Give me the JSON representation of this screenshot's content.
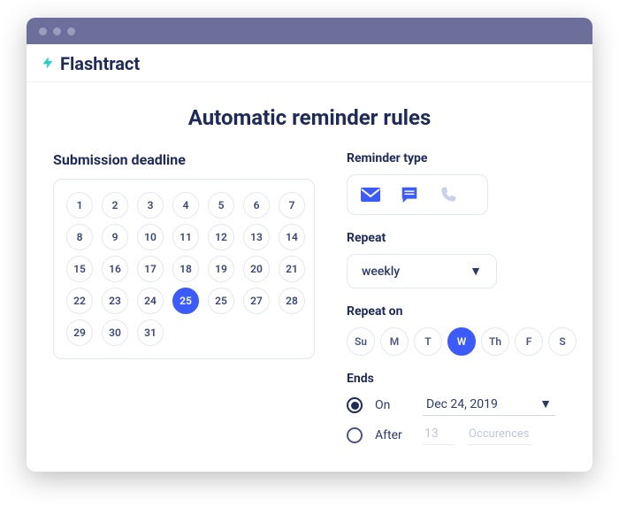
{
  "brand": {
    "name": "Flashtract"
  },
  "page": {
    "title": "Automatic reminder rules"
  },
  "deadline": {
    "label": "Submission deadline",
    "days": [
      "1",
      "2",
      "3",
      "4",
      "5",
      "6",
      "7",
      "8",
      "9",
      "10",
      "11",
      "12",
      "13",
      "14",
      "15",
      "16",
      "17",
      "18",
      "19",
      "20",
      "21",
      "22",
      "23",
      "24",
      "25",
      "25",
      "27",
      "28",
      "29",
      "30",
      "31"
    ],
    "selected_index": 24
  },
  "reminder_type": {
    "label": "Reminder type"
  },
  "repeat": {
    "label": "Repeat",
    "value": "weekly"
  },
  "repeat_on": {
    "label": "Repeat on",
    "days": [
      "Su",
      "M",
      "T",
      "W",
      "Th",
      "F",
      "S"
    ],
    "selected_index": 3
  },
  "ends": {
    "label": "Ends",
    "on_label": "On",
    "on_date": "Dec 24, 2019",
    "after_label": "After",
    "after_value": "13",
    "after_unit": "Occurences",
    "selected": "on"
  }
}
